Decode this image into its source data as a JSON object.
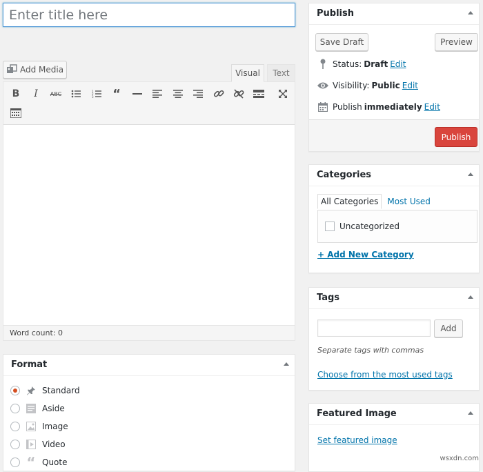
{
  "title_input": {
    "placeholder": "Enter title here",
    "value": ""
  },
  "add_media": {
    "label": "Add Media"
  },
  "editor_tabs": {
    "visual": "Visual",
    "text": "Text",
    "active": "Visual"
  },
  "toolbar": {
    "buttons": [
      {
        "name": "bold",
        "glyph": "B"
      },
      {
        "name": "italic",
        "glyph": "I"
      },
      {
        "name": "strikethrough",
        "glyph": "ABC"
      },
      {
        "name": "bulleted-list",
        "glyph": "☰"
      },
      {
        "name": "numbered-list",
        "glyph": "☰"
      },
      {
        "name": "blockquote",
        "glyph": "❝"
      },
      {
        "name": "horizontal-line",
        "glyph": "—"
      },
      {
        "name": "align-left",
        "glyph": "≡"
      },
      {
        "name": "align-center",
        "glyph": "≡"
      },
      {
        "name": "align-right",
        "glyph": "≡"
      },
      {
        "name": "insert-link",
        "glyph": "🔗"
      },
      {
        "name": "remove-link",
        "glyph": "⛓"
      },
      {
        "name": "read-more",
        "glyph": "▬"
      },
      {
        "name": "fullscreen",
        "glyph": "⤢"
      },
      {
        "name": "toolbar-toggle",
        "glyph": "▦"
      }
    ]
  },
  "status_bar": {
    "word_count_label": "Word count: 0"
  },
  "format": {
    "title": "Format",
    "options": [
      {
        "label": "Standard",
        "icon": "pin-icon",
        "selected": true
      },
      {
        "label": "Aside",
        "icon": "aside-icon",
        "selected": false
      },
      {
        "label": "Image",
        "icon": "image-icon",
        "selected": false
      },
      {
        "label": "Video",
        "icon": "video-icon",
        "selected": false
      },
      {
        "label": "Quote",
        "icon": "quote-icon",
        "selected": false
      }
    ]
  },
  "publish": {
    "title": "Publish",
    "save_draft": "Save Draft",
    "preview": "Preview",
    "status_label": "Status:",
    "status_value": "Draft",
    "visibility_label": "Visibility:",
    "visibility_value": "Public",
    "schedule_label": "Publish",
    "schedule_value": "immediately",
    "edit": "Edit",
    "publish_button": "Publish",
    "publish_color": "#d9453d"
  },
  "categories": {
    "title": "Categories",
    "tab_all": "All Categories",
    "tab_used": "Most Used",
    "items": [
      {
        "label": "Uncategorized",
        "checked": false
      }
    ],
    "add_new": "+ Add New Category"
  },
  "tags": {
    "title": "Tags",
    "input_value": "",
    "add_button": "Add",
    "hint": "Separate tags with commas",
    "choose_link": "Choose from the most used tags"
  },
  "featured_image": {
    "title": "Featured Image",
    "set_link": "Set featured image"
  },
  "watermark": "wsxdn.com",
  "colors": {
    "accent": "#0073aa",
    "focus": "#5b9dd9",
    "radio_selected": "#d54e21"
  }
}
